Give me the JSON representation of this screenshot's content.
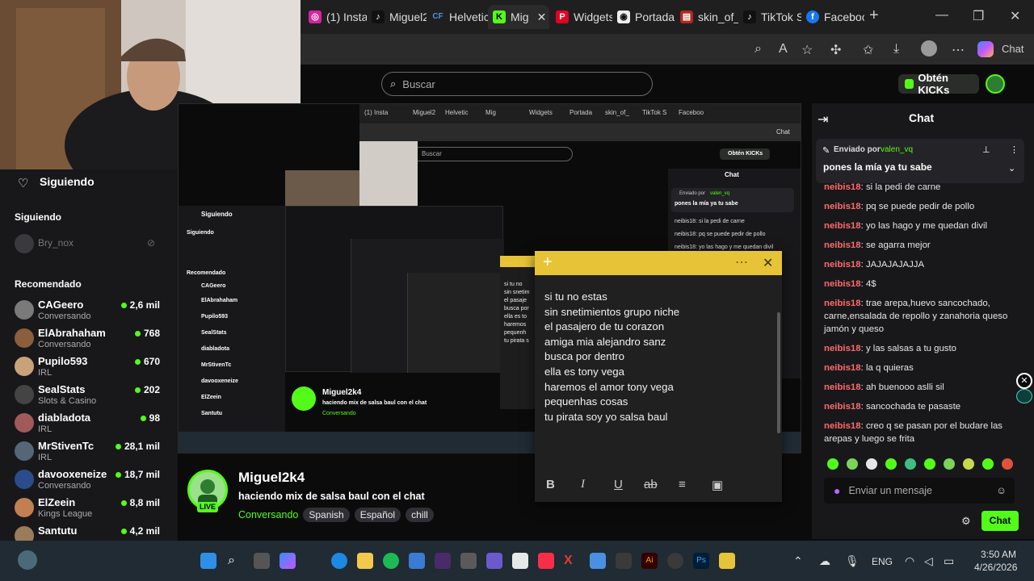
{
  "browser": {
    "tabs": [
      {
        "label": "(1) Insta",
        "color": "#d6249f",
        "glyph": "◎"
      },
      {
        "label": "Miguel2",
        "color": "#111111",
        "glyph": "♪"
      },
      {
        "label": "Helvetic",
        "color": "#2d6cdf",
        "glyph": "CF"
      },
      {
        "label": "Mig",
        "color": "#53fc18",
        "glyph": "K"
      },
      {
        "label": "Widgets",
        "color": "#e60023",
        "glyph": "P"
      },
      {
        "label": "Portada",
        "color": "#333333",
        "glyph": "◉"
      },
      {
        "label": "skin_of_",
        "color": "#b3261e",
        "glyph": "▤"
      },
      {
        "label": "TikTok S",
        "color": "#111111",
        "glyph": "♪"
      },
      {
        "label": "Faceboo",
        "color": "#1877f2",
        "glyph": "f"
      }
    ],
    "new_tab": "+",
    "copilot_label": "Chat"
  },
  "site": {
    "search_placeholder": "Buscar",
    "get_kicks_label": "Obtén KICKs"
  },
  "sidebar": {
    "following_header": "Siguiendo",
    "following_section": "Siguiendo",
    "offline_user": "Bry_nox",
    "recommended_header": "Recomendado",
    "items": [
      {
        "name": "CAGeero",
        "category": "Conversando",
        "count": "2,6 mil",
        "avatar": "#7a7a7a"
      },
      {
        "name": "ElAbrahaham",
        "category": "Conversando",
        "count": "768",
        "avatar": "#8b5e3c"
      },
      {
        "name": "Pupilo593",
        "category": "IRL",
        "count": "670",
        "avatar": "#c9a27a"
      },
      {
        "name": "SealStats",
        "category": "Slots & Casino",
        "count": "202",
        "avatar": "#444444"
      },
      {
        "name": "diabladota",
        "category": "IRL",
        "count": "98",
        "avatar": "#a05a5a"
      },
      {
        "name": "MrStivenTc",
        "category": "IRL",
        "count": "28,1 mil",
        "avatar": "#556677"
      },
      {
        "name": "davooxeneize",
        "category": "Conversando",
        "count": "18,7 mil",
        "avatar": "#2b4c8c"
      },
      {
        "name": "ElZeein",
        "category": "Kings League",
        "count": "8,8 mil",
        "avatar": "#c28050"
      },
      {
        "name": "Santutu",
        "category": "",
        "count": "4,2 mil",
        "avatar": "#9a7b5b"
      }
    ]
  },
  "stream": {
    "streamer": "Miguel2k4",
    "title": "haciendo mix de salsa baul con el chat",
    "category": "Conversando",
    "tags": [
      "Spanish",
      "Español",
      "chill"
    ],
    "live_badge": "LIVE"
  },
  "sticky_note": {
    "lines": [
      "si tu no estas",
      "sin snetimientos grupo niche",
      "el pasajero de tu corazon",
      "amiga mia alejandro sanz",
      "busca por dentro",
      "ella es tony vega",
      "haremos el amor tony vega",
      "pequenhas cosas",
      "tu pirata soy yo salsa baul"
    ],
    "toolbar": [
      "B",
      "I",
      "U",
      "ab",
      "≡",
      "▣"
    ]
  },
  "chat": {
    "title": "Chat",
    "pinned_by_prefix": "Enviado por",
    "pinned_by_user": "valen_vq",
    "pinned_message": "pones la mía ya tu sabe",
    "messages": [
      {
        "user": "neibis18",
        "text": "si la pedi de carne"
      },
      {
        "user": "neibis18",
        "text": "pq se puede pedir de pollo"
      },
      {
        "user": "neibis18",
        "text": "yo las hago y me quedan divil"
      },
      {
        "user": "neibis18",
        "text": "se agarra mejor"
      },
      {
        "user": "neibis18",
        "text": "JAJAJAJAJJA"
      },
      {
        "user": "neibis18",
        "text": "4$"
      },
      {
        "user": "neibis18",
        "text": "trae arepa,huevo sancochado, carne,ensalada de repollo y zanahoria queso jamón y queso"
      },
      {
        "user": "neibis18",
        "text": "y las salsas a tu gusto"
      },
      {
        "user": "neibis18",
        "text": "la q quieras"
      },
      {
        "user": "neibis18",
        "text": "ah buenooo aslli sil"
      },
      {
        "user": "neibis18",
        "text": "sancochada te pasaste"
      },
      {
        "user": "neibis18",
        "text": "creo q se pasan por el budare las arepas y luego se frita"
      }
    ],
    "input_placeholder": "Enviar un mensaje",
    "send_label": "Chat"
  },
  "nested": {
    "tabs": [
      "(1) Insta",
      "Miguel2",
      "Helvetic",
      "Mig",
      "Widgets",
      "Portada",
      "skin_of_",
      "TikTok S",
      "Faceboo"
    ],
    "search": "Buscar",
    "get_kicks": "Obtén KICKs",
    "chat_title": "Chat",
    "pinned_prefix": "Enviado por",
    "pinned_user": "valen_vq",
    "pinned_msg": "pones la mía ya tu sabe",
    "chat_lines": [
      "neibis18: si la pedi de carne",
      "neibis18: pq se puede pedir de pollo",
      "neibis18: yo las hago y me quedan divil"
    ],
    "following": "Siguiendo",
    "recommended": "Recomendado",
    "streamer": "Miguel2k4",
    "title": "haciendo mix de salsa baul con el chat",
    "category": "Conversando",
    "sticky_lines": [
      "si tu no",
      "sin snetim",
      "el pasaje",
      "busca por",
      "ella es to",
      "haremos",
      "pequenh",
      "tu pirata s"
    ]
  },
  "taskbar": {
    "language": "ENG",
    "time": "3:50 AM",
    "date": "4/26/2026"
  }
}
